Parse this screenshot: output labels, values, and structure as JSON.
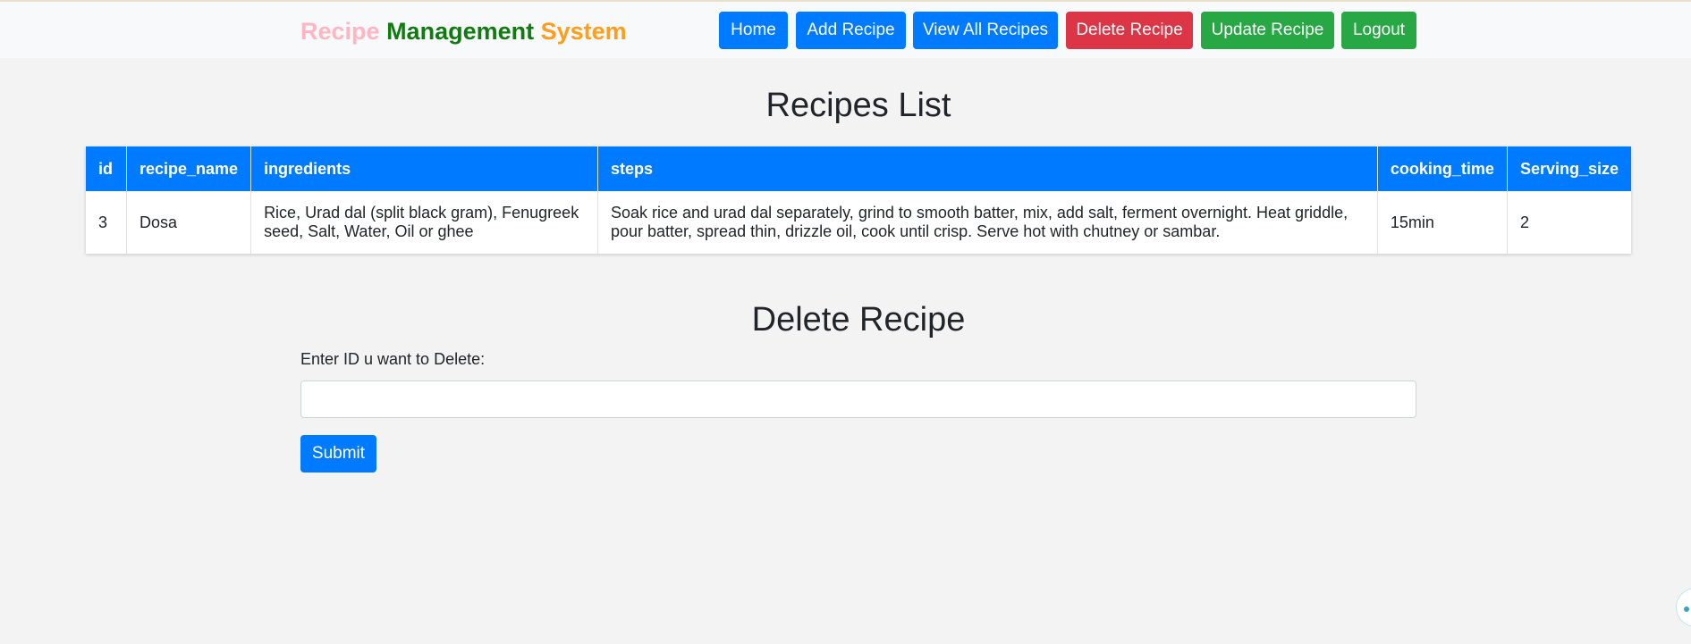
{
  "navbar": {
    "brand": {
      "part1": "Recipe",
      "part2": "Management",
      "part3": "System",
      "colors": [
        "#ffb6c1",
        "#117a11",
        "#ff9d1c"
      ]
    },
    "buttons": [
      {
        "label": "Home",
        "color": "#007bff"
      },
      {
        "label": "Add Recipe",
        "color": "#007bff"
      },
      {
        "label": "View All Recipes",
        "color": "#007bff"
      },
      {
        "label": "Delete Recipe",
        "color": "#dc3545"
      },
      {
        "label": "Update Recipe",
        "color": "#28a745"
      },
      {
        "label": "Logout",
        "color": "#28a745"
      }
    ]
  },
  "recipes": {
    "heading": "Recipes List",
    "columns": [
      "id",
      "recipe_name",
      "ingredients",
      "steps",
      "cooking_time",
      "Serving_size"
    ],
    "rows": [
      {
        "id": "3",
        "recipe_name": "Dosa",
        "ingredients": "Rice, Urad dal (split black gram), Fenugreek seed, Salt, Water, Oil or ghee",
        "steps": "Soak rice and urad dal separately, grind to smooth batter, mix, add salt, ferment overnight. Heat griddle, pour batter, spread thin, drizzle oil, cook until crisp. Serve hot with chutney or sambar.",
        "cooking_time": "15min",
        "serving_size": "2"
      }
    ]
  },
  "delete_form": {
    "heading": "Delete Recipe",
    "label": "Enter ID u want to Delete:",
    "input_value": "",
    "submit_label": "Submit"
  },
  "widgets": {
    "chat_icon": "chat-bubble-icon"
  }
}
